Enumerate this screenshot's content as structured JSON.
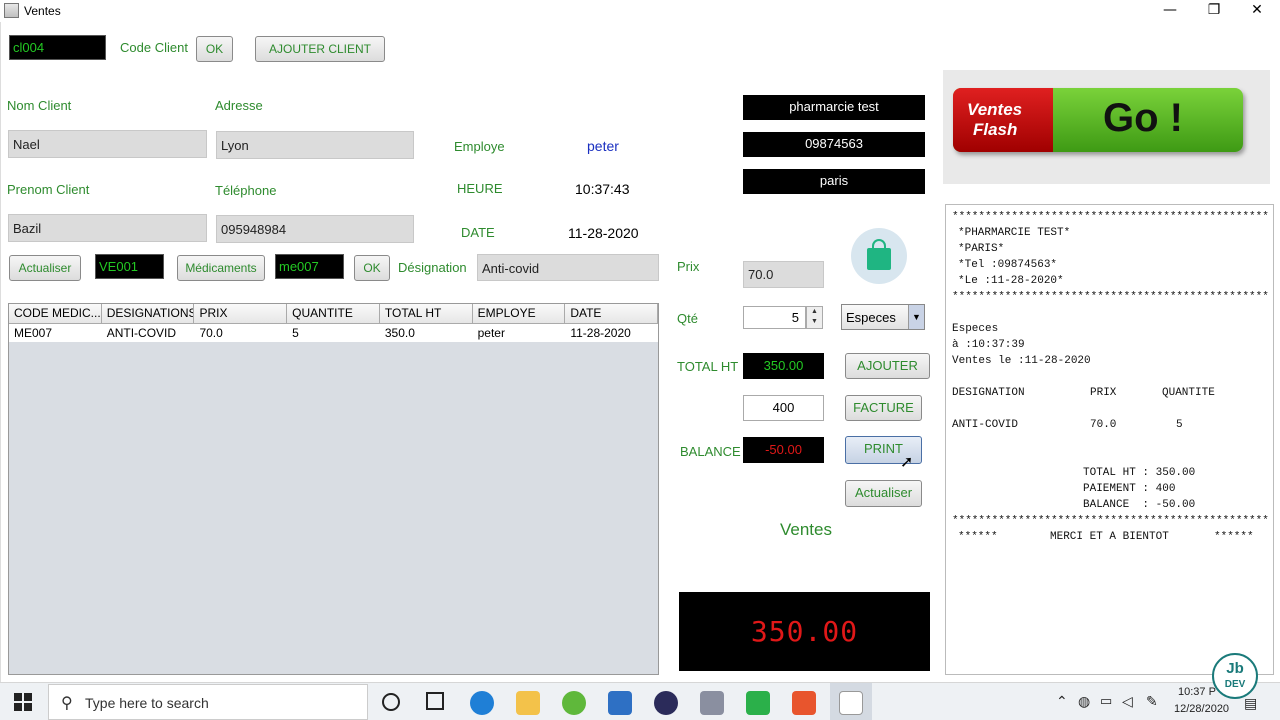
{
  "window": {
    "title": "Ventes",
    "minimize": "—",
    "maximize": "❐",
    "close": "✕"
  },
  "client": {
    "code_value": "cl004",
    "code_label": "Code Client",
    "ok_label": "OK",
    "add_label": "AJOUTER CLIENT",
    "nom_label": "Nom Client",
    "nom_value": "Nael",
    "adresse_label": "Adresse",
    "adresse_value": "Lyon",
    "prenom_label": "Prenom Client",
    "prenom_value": "Bazil",
    "tel_label": "Téléphone",
    "tel_value": "095948984"
  },
  "info": {
    "employe_label": "Employe",
    "employe_value": "peter",
    "heure_label": "HEURE",
    "heure_value": "10:37:43",
    "date_label": "DATE",
    "date_value": "11-28-2020"
  },
  "store": {
    "name": "pharmarcie test",
    "phone": "09874563",
    "city": "paris"
  },
  "toolbar": {
    "actualiser_label": "Actualiser",
    "vente_value": "VE001",
    "medicaments_label": "Médicaments",
    "med_code_value": "me007",
    "ok_label": "OK",
    "designation_label": "Désignation",
    "designation_value": "Anti-covid"
  },
  "table": {
    "headers": [
      "CODE MEDIC...",
      "DESIGNATIONS",
      "PRIX",
      "QUANTITE",
      "TOTAL HT",
      "EMPLOYE",
      "DATE"
    ],
    "rows": [
      [
        "ME007",
        "ANTI-COVID",
        "70.0",
        "5",
        "350.0",
        "peter",
        "11-28-2020"
      ]
    ]
  },
  "sale": {
    "prix_label": "Prix",
    "prix_value": "70.0",
    "qte_label": "Qté",
    "qte_value": "5",
    "payment_value": "Especes",
    "total_label": "TOTAL HT",
    "total_value": "350.00",
    "paid_value": "400",
    "balance_label": "BALANCE",
    "balance_value": "-50.00",
    "ajouter_label": "AJOUTER",
    "facture_label": "FACTURE",
    "print_label": "PRINT",
    "actualiser_label": "Actualiser",
    "ventes_label": "Ventes",
    "display_value": "350.00"
  },
  "banner": {
    "brand_line1": "Ventes",
    "brand_line2": "Flash",
    "go": "Go !"
  },
  "receipt": {
    "stars": "************************************************",
    "line1": "*PHARMARCIE TEST*",
    "line2": "*PARIS*",
    "line3": "*Tel :09874563*",
    "line4": "*Le :11-28-2020*",
    "pay": "Especes",
    "time": "à :10:37:39",
    "sold": "Ventes le :11-28-2020",
    "h_des": "DESIGNATION",
    "h_prix": "PRIX",
    "h_qte": "QUANTITE",
    "r_des": "ANTI-COVID",
    "r_prix": "70.0",
    "r_qte": "5",
    "total": "TOTAL HT : 350.00",
    "paiement": "PAIEMENT : 400",
    "balance": "BALANCE  : -50.00",
    "footer_left": "******",
    "footer_mid": "MERCI ET A BIENTOT",
    "footer_right": "******"
  },
  "taskbar": {
    "search_placeholder": "Type here to search",
    "time": "10:37 P",
    "date": "12/28/2020",
    "badge_top": "Jb",
    "badge_bottom": "DEV"
  },
  "colors": {
    "green": "#2e8b2e",
    "blue": "#1a2fc0",
    "red": "#e01818",
    "lcd_bg": "#000000"
  }
}
